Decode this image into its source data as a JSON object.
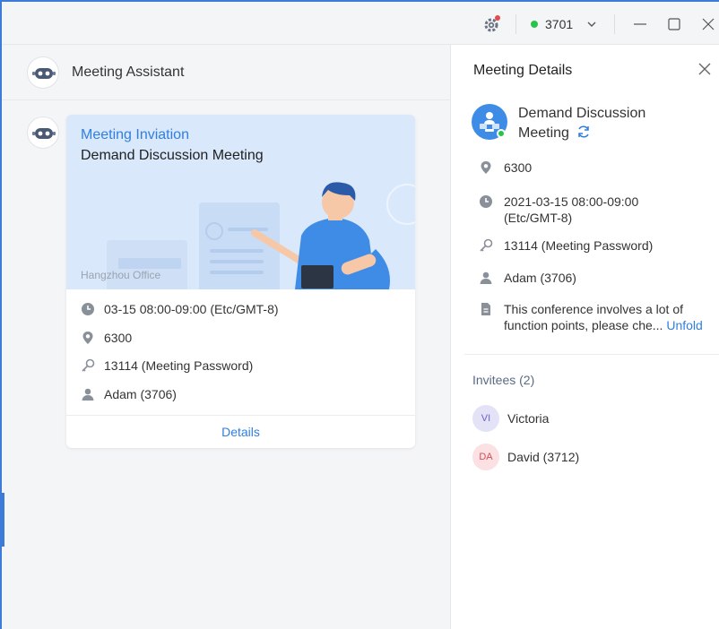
{
  "titlebar": {
    "status_text": "3701",
    "status_color": "#28c44a",
    "icons": [
      "settings-gear-icon",
      "chevron-down-icon",
      "minimize-icon",
      "maximize-icon",
      "close-icon"
    ]
  },
  "left": {
    "title": "Meeting Assistant",
    "card": {
      "kind": "Meeting Inviation",
      "title": "Demand Discussion Meeting",
      "watermark": "Hangzhou Office",
      "rows": [
        {
          "icon": "clock-icon",
          "text": "03-15 08:00-09:00   (Etc/GMT-8)"
        },
        {
          "icon": "location-pin-icon",
          "text": "6300"
        },
        {
          "icon": "key-icon",
          "text": "13114 (Meeting Password)"
        },
        {
          "icon": "person-icon",
          "text": "Adam (3706)"
        }
      ],
      "details_label": "Details"
    }
  },
  "right": {
    "title": "Meeting Details",
    "meeting_title": "Demand Discussion Meeting",
    "rows": [
      {
        "icon": "location-pin-icon",
        "text": "6300"
      },
      {
        "icon": "clock-icon",
        "text": "2021-03-15 08:00-09:00   (Etc/GMT-8)"
      },
      {
        "icon": "key-icon",
        "text": "13114 (Meeting Password)"
      },
      {
        "icon": "person-icon",
        "text": "Adam (3706)"
      }
    ],
    "description": "This conference involves a lot of function points, please che...",
    "unfold_label": "Unfold",
    "invitees_title": "Invitees (2)",
    "invitees": [
      {
        "initials": "VI",
        "name": "Victoria",
        "bg": "#e4e2f7",
        "fg": "#6a63c9"
      },
      {
        "initials": "DA",
        "name": "David (3712)",
        "bg": "#fbe1e3",
        "fg": "#d44b57"
      }
    ]
  },
  "colors": {
    "accent": "#2f7fe0",
    "online": "#28c44a",
    "window_border": "#3d7bd8"
  }
}
